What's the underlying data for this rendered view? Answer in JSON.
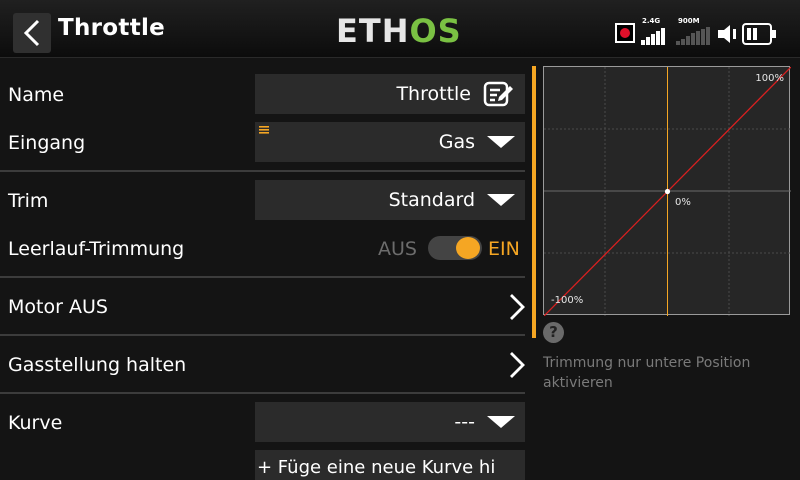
{
  "header": {
    "title": "Throttle",
    "logo_part1": "ETH",
    "logo_part2": "OS",
    "signal1_label": "2.4G",
    "signal2_label": "900M"
  },
  "rows": {
    "name_label": "Name",
    "name_value": "Throttle",
    "input_label": "Eingang",
    "input_value": "Gas",
    "trim_label": "Trim",
    "trim_value": "Standard",
    "idle_trim_label": "Leerlauf-Trimmung",
    "idle_trim_off": "AUS",
    "idle_trim_on": "EIN",
    "idle_trim_state": true,
    "motor_off_label": "Motor AUS",
    "hold_label": "Gasstellung halten",
    "curve_label": "Kurve",
    "curve_value": "---",
    "add_curve": "+ Füge eine neue Kurve hi"
  },
  "graph": {
    "top_label": "100%",
    "mid_label": "0%",
    "bottom_label": "-100%",
    "line_color": "#d92020",
    "cursor_color": "#f5a623",
    "cursor_x": 0,
    "cursor_y": 0
  },
  "help": {
    "text": "Trimmung nur untere Position aktivieren"
  },
  "colors": {
    "accent": "#f5a623",
    "brand_green": "#7ac143",
    "record": "#e0102a"
  }
}
